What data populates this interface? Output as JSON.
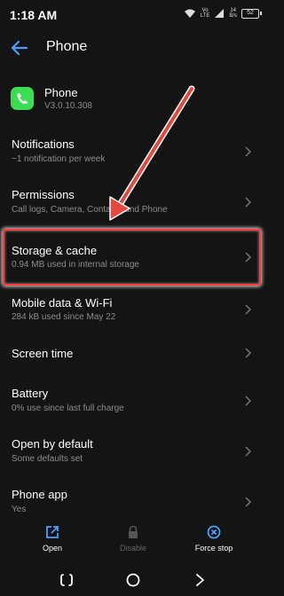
{
  "status_bar": {
    "time": "1:18 AM",
    "network_top": "Vo",
    "network_bottom": "LTE",
    "data_top": "14",
    "data_bottom": "B/s",
    "battery": "52",
    "icons": [
      "wifi-icon",
      "signal-icon",
      "battery-icon"
    ]
  },
  "app_bar": {
    "title": "Phone",
    "back_icon": "back-arrow-icon"
  },
  "app": {
    "name": "Phone",
    "version": "V3.0.10.308",
    "icon": "phone-app-icon",
    "icon_color": "#3ddc55"
  },
  "settings": [
    {
      "title": "Notifications",
      "subtitle": "~1 notification per week"
    },
    {
      "title": "Permissions",
      "subtitle": "Call logs, Camera, Contacts and Phone"
    },
    {
      "title": "Storage & cache",
      "subtitle": "0.94 MB used in internal storage"
    },
    {
      "title": "Mobile data & Wi-Fi",
      "subtitle": "284 kB used since May 22"
    },
    {
      "title": "Screen time",
      "subtitle": ""
    },
    {
      "title": "Battery",
      "subtitle": "0% use since last full charge"
    },
    {
      "title": "Open by default",
      "subtitle": "Some defaults set"
    },
    {
      "title": "Phone app",
      "subtitle": "Yes"
    }
  ],
  "actions": [
    {
      "label": "Open",
      "icon": "open-external-icon",
      "enabled": true
    },
    {
      "label": "Disable",
      "icon": "lock-icon",
      "enabled": false
    },
    {
      "label": "Force stop",
      "icon": "force-stop-icon",
      "enabled": true
    }
  ],
  "colors": {
    "background": "#141414",
    "accent": "#4a9eff",
    "highlight": "#ff3b3b"
  }
}
